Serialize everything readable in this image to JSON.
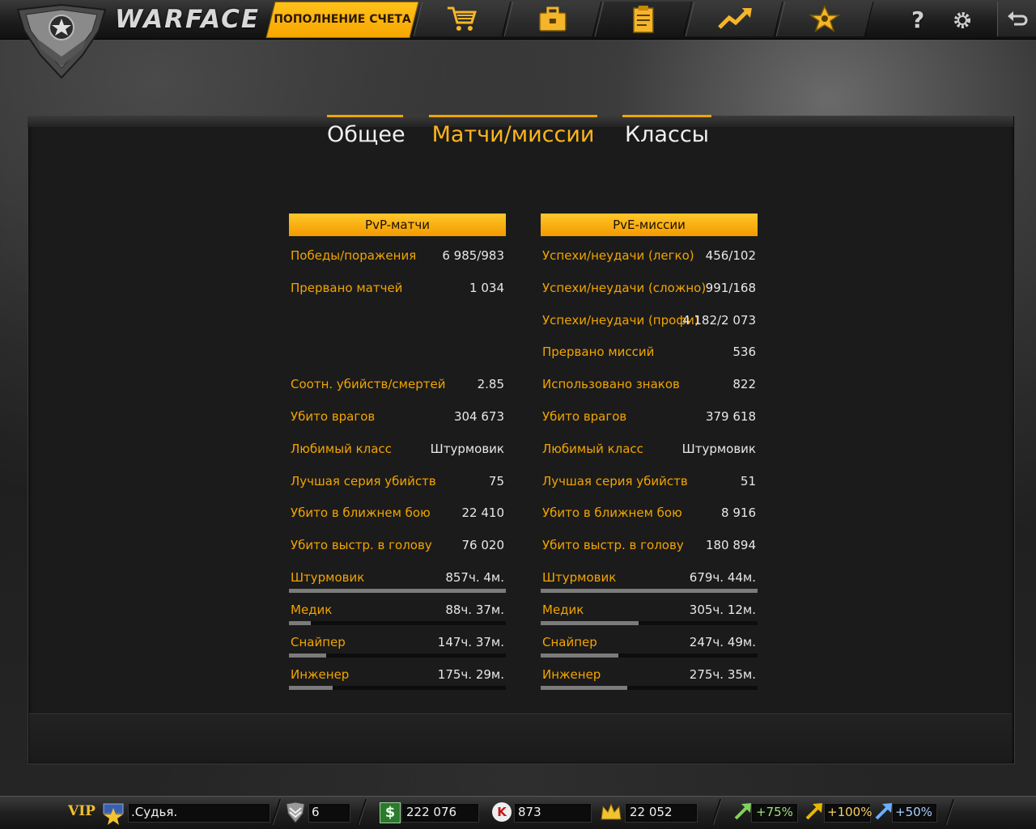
{
  "app": {
    "logo_text": "WARFACE"
  },
  "topbar": {
    "topup_label": "ПОПОЛНЕНИЕ СЧЕТА",
    "nav_icons": [
      "cart-icon",
      "inventory-icon",
      "stats-icon",
      "rating-icon",
      "achievements-icon"
    ],
    "active_nav": "stats-icon",
    "help_label": "?"
  },
  "tabs": [
    {
      "label": "Общее",
      "active": false
    },
    {
      "label": "Матчи/миссии",
      "active": true
    },
    {
      "label": "Классы",
      "active": false
    }
  ],
  "pvp": {
    "header": "PvP-матчи",
    "rows": [
      {
        "label": "Победы/поражения",
        "value": "6 985/983"
      },
      {
        "label": "Прервано матчей",
        "value": "1 034"
      },
      {
        "label": "Соотн. убийств/смертей",
        "value": "2.85"
      },
      {
        "label": "Убито врагов",
        "value": "304 673"
      },
      {
        "label": "Любимый класс",
        "value": "Штурмовик"
      },
      {
        "label": "Лучшая серия убийств",
        "value": "75"
      },
      {
        "label": "Убито в ближнем бою",
        "value": "22 410"
      },
      {
        "label": "Убито выстр. в голову",
        "value": "76 020"
      }
    ],
    "classes": [
      {
        "label": "Штурмовик",
        "value": "857ч. 4м.",
        "fill": 1.0
      },
      {
        "label": "Медик",
        "value": "88ч. 37м.",
        "fill": 0.1
      },
      {
        "label": "Снайпер",
        "value": "147ч. 37м.",
        "fill": 0.17
      },
      {
        "label": "Инженер",
        "value": "175ч. 29м.",
        "fill": 0.2
      }
    ]
  },
  "pve": {
    "header": "PvE-миссии",
    "rows": [
      {
        "label": "Успехи/неудачи (легко)",
        "value": "456/102"
      },
      {
        "label": "Успехи/неудачи (сложно)",
        "value": "991/168"
      },
      {
        "label": "Успехи/неудачи (профи)",
        "value": "4 182/2 073"
      },
      {
        "label": "Прервано миссий",
        "value": "536"
      },
      {
        "label": "Использовано знаков",
        "value": "822"
      },
      {
        "label": "Убито врагов",
        "value": "379 618"
      },
      {
        "label": "Любимый класс",
        "value": "Штурмовик"
      },
      {
        "label": "Лучшая серия убийств",
        "value": "51"
      },
      {
        "label": "Убито в ближнем бою",
        "value": "8 916"
      },
      {
        "label": "Убито выстр. в голову",
        "value": "180 894"
      }
    ],
    "classes": [
      {
        "label": "Штурмовик",
        "value": "679ч. 44м.",
        "fill": 1.0
      },
      {
        "label": "Медик",
        "value": "305ч. 12м.",
        "fill": 0.45
      },
      {
        "label": "Снайпер",
        "value": "247ч. 49м.",
        "fill": 0.36
      },
      {
        "label": "Инженер",
        "value": "275ч. 35м.",
        "fill": 0.4
      }
    ]
  },
  "bottombar": {
    "vip_label": "VIP",
    "player_name": ".Судья.",
    "rank_value": "6",
    "currency": "222 076",
    "kredits": "873",
    "crowns": "22 052",
    "boost_xp": "+75%",
    "boost_money": "+100%",
    "boost_vp": "+50%"
  },
  "colors": {
    "accent": "#f2a400",
    "header_gradient_top": "#ffc72a",
    "header_gradient_bottom": "#f39a00",
    "boost_xp": "#7fd25a",
    "boost_money": "#e8b800",
    "boost_vp": "#6ab0ff"
  }
}
